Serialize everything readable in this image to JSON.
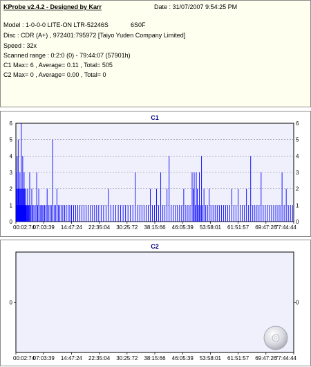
{
  "header": {
    "title": "KProbe v2.4.2 - Designed by Karr",
    "date": "Date : 31/07/2007 9:54:25 PM",
    "model": "Model : 1-0-0-0 LITE-ON LTR-52246S",
    "firmware": "6S0F",
    "disc": "Disc : CDR (A+) , 972401:795972 [Taiyo Yuden Company Limited]",
    "speed": "Speed : 32x",
    "range": "Scanned range : 0:2:0 (0) - 79:44:07 (57901h)",
    "c1_stats": "C1 Max= 6 , Average= 0.11 , Total= 505",
    "c2_stats": "C2 Max= 0 , Average= 0.00 , Total= 0"
  },
  "chart_data": [
    {
      "type": "bar",
      "title": "C1",
      "color": "#0000ff",
      "ylim": [
        0,
        6
      ],
      "yticks": [
        "0",
        "1",
        "2",
        "3",
        "4",
        "5",
        "6"
      ],
      "xlabel": "",
      "ylabel": "",
      "x_tick_labels": [
        "00:02:74",
        "07:03:39",
        "14:47:24",
        "22:35:04",
        "30:25:72",
        "38:15:66",
        "46:05:39",
        "53:58:01",
        "61:51:57",
        "69:47:26",
        "77:44:44"
      ],
      "x_range_minutes": [
        0.04,
        79.75
      ],
      "grid": true,
      "events": [
        {
          "t": 0.1,
          "v": 3
        },
        {
          "t": 0.2,
          "v": 2
        },
        {
          "t": 0.3,
          "v": 1
        },
        {
          "t": 0.4,
          "v": 4
        },
        {
          "t": 0.5,
          "v": 2
        },
        {
          "t": 0.6,
          "v": 1
        },
        {
          "t": 0.7,
          "v": 5
        },
        {
          "t": 0.8,
          "v": 2
        },
        {
          "t": 0.9,
          "v": 1
        },
        {
          "t": 1.0,
          "v": 2
        },
        {
          "t": 1.1,
          "v": 1
        },
        {
          "t": 1.2,
          "v": 3
        },
        {
          "t": 1.3,
          "v": 1
        },
        {
          "t": 1.4,
          "v": 2
        },
        {
          "t": 1.5,
          "v": 1
        },
        {
          "t": 1.6,
          "v": 6
        },
        {
          "t": 1.7,
          "v": 1
        },
        {
          "t": 1.8,
          "v": 2
        },
        {
          "t": 1.9,
          "v": 1
        },
        {
          "t": 2.0,
          "v": 4
        },
        {
          "t": 2.1,
          "v": 1
        },
        {
          "t": 2.2,
          "v": 2
        },
        {
          "t": 2.3,
          "v": 1
        },
        {
          "t": 2.4,
          "v": 3
        },
        {
          "t": 2.5,
          "v": 1
        },
        {
          "t": 2.6,
          "v": 2
        },
        {
          "t": 2.7,
          "v": 1
        },
        {
          "t": 2.8,
          "v": 1
        },
        {
          "t": 2.9,
          "v": 2
        },
        {
          "t": 3.0,
          "v": 1
        },
        {
          "t": 3.2,
          "v": 1
        },
        {
          "t": 3.4,
          "v": 2
        },
        {
          "t": 3.6,
          "v": 1
        },
        {
          "t": 3.8,
          "v": 1
        },
        {
          "t": 4.0,
          "v": 3
        },
        {
          "t": 4.3,
          "v": 1
        },
        {
          "t": 4.6,
          "v": 2
        },
        {
          "t": 4.9,
          "v": 1
        },
        {
          "t": 5.2,
          "v": 1
        },
        {
          "t": 5.6,
          "v": 1
        },
        {
          "t": 6.0,
          "v": 3
        },
        {
          "t": 6.3,
          "v": 1
        },
        {
          "t": 6.6,
          "v": 2
        },
        {
          "t": 7.0,
          "v": 1
        },
        {
          "t": 7.3,
          "v": 1
        },
        {
          "t": 7.6,
          "v": 1
        },
        {
          "t": 8.0,
          "v": 1
        },
        {
          "t": 8.3,
          "v": 1
        },
        {
          "t": 8.7,
          "v": 1
        },
        {
          "t": 9.0,
          "v": 2
        },
        {
          "t": 9.4,
          "v": 1
        },
        {
          "t": 9.8,
          "v": 1
        },
        {
          "t": 10.2,
          "v": 1
        },
        {
          "t": 10.6,
          "v": 5
        },
        {
          "t": 11.0,
          "v": 1
        },
        {
          "t": 11.4,
          "v": 1
        },
        {
          "t": 11.8,
          "v": 2
        },
        {
          "t": 12.2,
          "v": 1
        },
        {
          "t": 12.6,
          "v": 1
        },
        {
          "t": 13.0,
          "v": 1
        },
        {
          "t": 13.5,
          "v": 1
        },
        {
          "t": 14.0,
          "v": 1
        },
        {
          "t": 14.5,
          "v": 1
        },
        {
          "t": 15.0,
          "v": 1
        },
        {
          "t": 15.5,
          "v": 1
        },
        {
          "t": 16.0,
          "v": 1
        },
        {
          "t": 16.6,
          "v": 1
        },
        {
          "t": 17.2,
          "v": 1
        },
        {
          "t": 17.8,
          "v": 1
        },
        {
          "t": 18.4,
          "v": 1
        },
        {
          "t": 19.0,
          "v": 1
        },
        {
          "t": 19.6,
          "v": 1
        },
        {
          "t": 20.2,
          "v": 1
        },
        {
          "t": 20.8,
          "v": 1
        },
        {
          "t": 21.4,
          "v": 1
        },
        {
          "t": 22.0,
          "v": 1
        },
        {
          "t": 22.6,
          "v": 1
        },
        {
          "t": 23.2,
          "v": 1
        },
        {
          "t": 23.8,
          "v": 1
        },
        {
          "t": 24.5,
          "v": 1
        },
        {
          "t": 25.2,
          "v": 1
        },
        {
          "t": 25.9,
          "v": 1
        },
        {
          "t": 26.6,
          "v": 2
        },
        {
          "t": 27.3,
          "v": 1
        },
        {
          "t": 28.0,
          "v": 1
        },
        {
          "t": 28.7,
          "v": 1
        },
        {
          "t": 29.4,
          "v": 1
        },
        {
          "t": 30.1,
          "v": 1
        },
        {
          "t": 30.8,
          "v": 1
        },
        {
          "t": 31.5,
          "v": 1
        },
        {
          "t": 32.2,
          "v": 1
        },
        {
          "t": 32.9,
          "v": 1
        },
        {
          "t": 33.6,
          "v": 1
        },
        {
          "t": 34.3,
          "v": 3
        },
        {
          "t": 35.0,
          "v": 1
        },
        {
          "t": 35.6,
          "v": 1
        },
        {
          "t": 36.2,
          "v": 1
        },
        {
          "t": 36.8,
          "v": 1
        },
        {
          "t": 37.4,
          "v": 1
        },
        {
          "t": 38.0,
          "v": 1
        },
        {
          "t": 38.6,
          "v": 2
        },
        {
          "t": 39.2,
          "v": 1
        },
        {
          "t": 39.8,
          "v": 1
        },
        {
          "t": 40.4,
          "v": 2
        },
        {
          "t": 41.0,
          "v": 1
        },
        {
          "t": 41.6,
          "v": 3
        },
        {
          "t": 42.2,
          "v": 1
        },
        {
          "t": 42.8,
          "v": 1
        },
        {
          "t": 43.4,
          "v": 2
        },
        {
          "t": 44.0,
          "v": 4
        },
        {
          "t": 44.6,
          "v": 1
        },
        {
          "t": 45.2,
          "v": 1
        },
        {
          "t": 45.8,
          "v": 1
        },
        {
          "t": 46.4,
          "v": 1
        },
        {
          "t": 47.0,
          "v": 1
        },
        {
          "t": 47.6,
          "v": 1
        },
        {
          "t": 48.2,
          "v": 2
        },
        {
          "t": 48.8,
          "v": 1
        },
        {
          "t": 49.4,
          "v": 1
        },
        {
          "t": 50.0,
          "v": 1
        },
        {
          "t": 50.6,
          "v": 3
        },
        {
          "t": 50.9,
          "v": 2
        },
        {
          "t": 51.2,
          "v": 3
        },
        {
          "t": 51.5,
          "v": 1
        },
        {
          "t": 51.8,
          "v": 3
        },
        {
          "t": 52.1,
          "v": 2
        },
        {
          "t": 52.4,
          "v": 1
        },
        {
          "t": 52.7,
          "v": 3
        },
        {
          "t": 53.0,
          "v": 1
        },
        {
          "t": 53.3,
          "v": 4
        },
        {
          "t": 53.6,
          "v": 1
        },
        {
          "t": 54.0,
          "v": 2
        },
        {
          "t": 54.5,
          "v": 1
        },
        {
          "t": 55.0,
          "v": 1
        },
        {
          "t": 55.5,
          "v": 2
        },
        {
          "t": 56.0,
          "v": 1
        },
        {
          "t": 56.6,
          "v": 1
        },
        {
          "t": 57.2,
          "v": 1
        },
        {
          "t": 57.8,
          "v": 1
        },
        {
          "t": 58.4,
          "v": 1
        },
        {
          "t": 59.0,
          "v": 1
        },
        {
          "t": 59.6,
          "v": 1
        },
        {
          "t": 60.2,
          "v": 1
        },
        {
          "t": 60.8,
          "v": 1
        },
        {
          "t": 61.4,
          "v": 1
        },
        {
          "t": 62.0,
          "v": 2
        },
        {
          "t": 62.6,
          "v": 1
        },
        {
          "t": 63.2,
          "v": 1
        },
        {
          "t": 63.8,
          "v": 2
        },
        {
          "t": 64.4,
          "v": 1
        },
        {
          "t": 65.0,
          "v": 1
        },
        {
          "t": 65.6,
          "v": 1
        },
        {
          "t": 66.2,
          "v": 2
        },
        {
          "t": 66.8,
          "v": 1
        },
        {
          "t": 67.4,
          "v": 4
        },
        {
          "t": 68.0,
          "v": 1
        },
        {
          "t": 68.6,
          "v": 1
        },
        {
          "t": 69.2,
          "v": 1
        },
        {
          "t": 69.8,
          "v": 1
        },
        {
          "t": 70.4,
          "v": 3
        },
        {
          "t": 71.0,
          "v": 1
        },
        {
          "t": 71.6,
          "v": 1
        },
        {
          "t": 72.2,
          "v": 1
        },
        {
          "t": 72.8,
          "v": 1
        },
        {
          "t": 73.4,
          "v": 1
        },
        {
          "t": 74.0,
          "v": 1
        },
        {
          "t": 74.6,
          "v": 1
        },
        {
          "t": 75.2,
          "v": 1
        },
        {
          "t": 75.8,
          "v": 1
        },
        {
          "t": 76.4,
          "v": 3
        },
        {
          "t": 77.0,
          "v": 1
        },
        {
          "t": 77.6,
          "v": 2
        },
        {
          "t": 78.2,
          "v": 1
        },
        {
          "t": 78.8,
          "v": 1
        },
        {
          "t": 79.4,
          "v": 1
        }
      ]
    },
    {
      "type": "bar",
      "title": "C2",
      "color": "#0000ff",
      "ylim": [
        -1,
        1
      ],
      "yticks": [
        "0"
      ],
      "xlabel": "",
      "ylabel": "",
      "x_tick_labels": [
        "00:02:74",
        "07:03:39",
        "14:47:24",
        "22:35:04",
        "30:25:72",
        "38:15:66",
        "46:05:39",
        "53:58:01",
        "61:51:57",
        "69:47:26",
        "77:44:44"
      ],
      "grid": false,
      "events": []
    }
  ]
}
